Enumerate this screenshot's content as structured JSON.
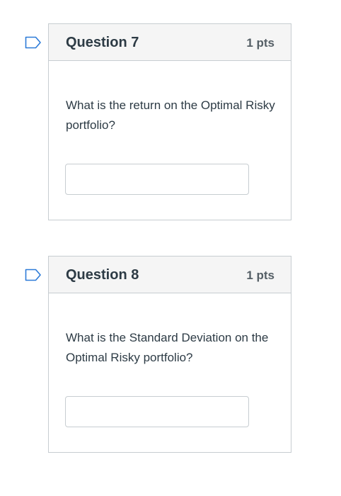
{
  "questions": [
    {
      "title": "Question 7",
      "points": "1 pts",
      "text": "What is the return on the Optimal Risky portfolio?",
      "answer_value": ""
    },
    {
      "title": "Question 8",
      "points": "1 pts",
      "text": "What is the Standard Deviation on the Optimal Risky portfolio?",
      "answer_value": ""
    }
  ],
  "icons": {
    "flag": "bookmark-flag-icon"
  },
  "colors": {
    "flag_stroke": "#2d7bd8",
    "header_bg": "#f5f5f5",
    "border": "#c7cdd1"
  }
}
